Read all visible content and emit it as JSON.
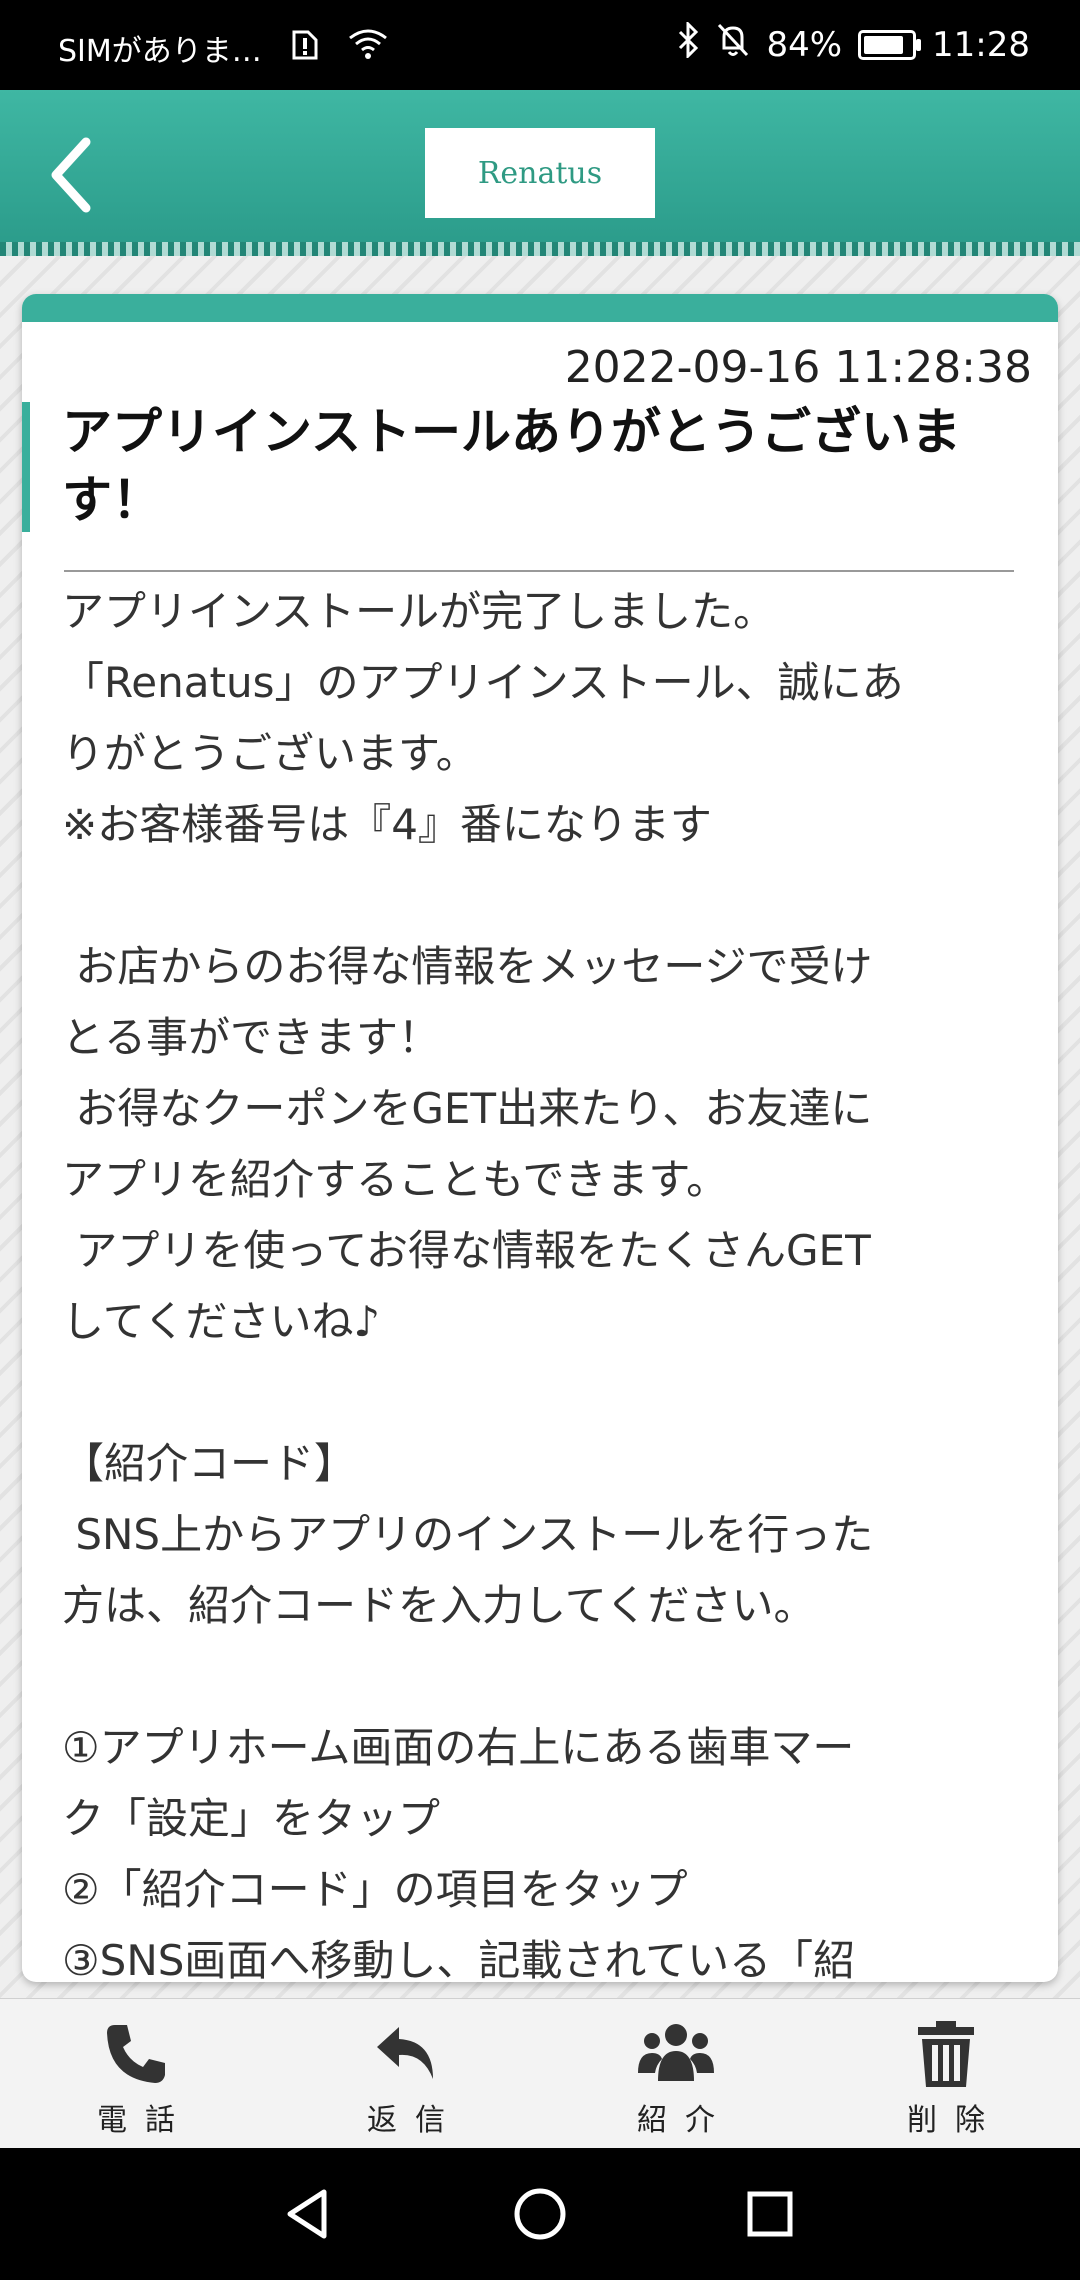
{
  "status_bar": {
    "carrier": "SIMがありま…",
    "battery_percent": "84%",
    "battery_level": 0.84,
    "time": "11:28"
  },
  "header": {
    "logo_text": "Renatus",
    "back_icon": "chevron-left-icon"
  },
  "message": {
    "date": "2022-09-16 11:28:38",
    "title": "アプリインストールありがとうございます！",
    "body_lines": [
      "アプリインストールが完了しました。",
      "「Renatus」のアプリインストール、誠にあ",
      "りがとうございます。",
      "※お客様番号は『4』番になります",
      "",
      " お店からのお得な情報をメッセージで受け",
      "とる事ができます！",
      " お得なクーポンをGET出来たり、お友達に",
      "アプリを紹介することもできます。",
      " アプリを使ってお得な情報をたくさんGET",
      "してくださいね♪",
      "",
      "【紹介コード】",
      " SNS上からアプリのインストールを行った",
      "方は、紹介コードを入力してください。",
      "",
      "①アプリホーム画面の右上にある歯車マー",
      "ク「設定」をタップ",
      "②「紹介コード」の項目をタップ",
      "③SNS画面へ移動し、記載されている「紹"
    ]
  },
  "actions": [
    {
      "label": "電話",
      "icon": "phone-icon"
    },
    {
      "label": "返信",
      "icon": "reply-icon"
    },
    {
      "label": "紹介",
      "icon": "users-icon"
    },
    {
      "label": "削除",
      "icon": "trash-icon"
    }
  ],
  "nav": [
    "back",
    "home",
    "recents"
  ]
}
